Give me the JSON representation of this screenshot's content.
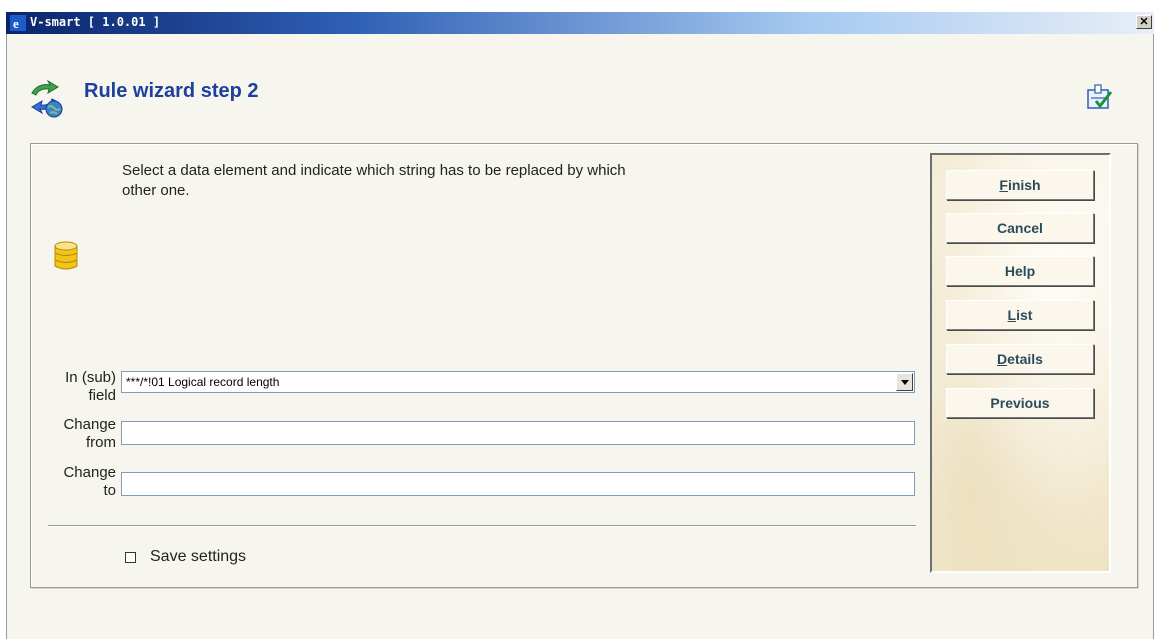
{
  "window": {
    "title": "V-smart [ 1.0.01 ]",
    "close_glyph": "✕"
  },
  "header": {
    "title": "Rule wizard step 2",
    "icon": "refresh-globe-icon",
    "wizard_icon": "wizard-check-icon"
  },
  "instruction": "Select a data element and indicate which string has to be replaced by which other one.",
  "form": {
    "subfield": {
      "label_line1": "In (sub)",
      "label_line2": "field",
      "value": "***/*!01 Logical record length"
    },
    "change_from": {
      "label_line1": "Change",
      "label_line2": "from",
      "value": ""
    },
    "change_to": {
      "label_line1": "Change",
      "label_line2": "to",
      "value": ""
    },
    "save_settings": {
      "label": "Save settings",
      "checked": false
    }
  },
  "buttons": {
    "finish": {
      "first": "F",
      "rest": "inish"
    },
    "cancel": {
      "label": "Cancel"
    },
    "help": {
      "label": "Help"
    },
    "list": {
      "first": "L",
      "rest": "ist"
    },
    "details": {
      "first": "D",
      "rest": "etails"
    },
    "previous": {
      "label": "Previous"
    }
  },
  "colors": {
    "title": "#1e3f9e",
    "button_text": "#2b4c5a",
    "titlebar": "#0a246a"
  }
}
